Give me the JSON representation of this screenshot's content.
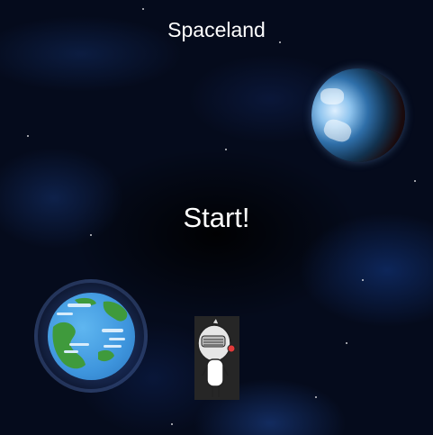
{
  "game": {
    "title": "Spaceland",
    "start_label": "Start!"
  },
  "colors": {
    "background": "#050b1c",
    "text": "#ffffff",
    "ocean": "#3e95dd",
    "land": "#3f9a3c"
  },
  "icons": {
    "player": "knight-character-icon",
    "planet_top": "planet-icon",
    "earth": "earth-planet-icon"
  }
}
